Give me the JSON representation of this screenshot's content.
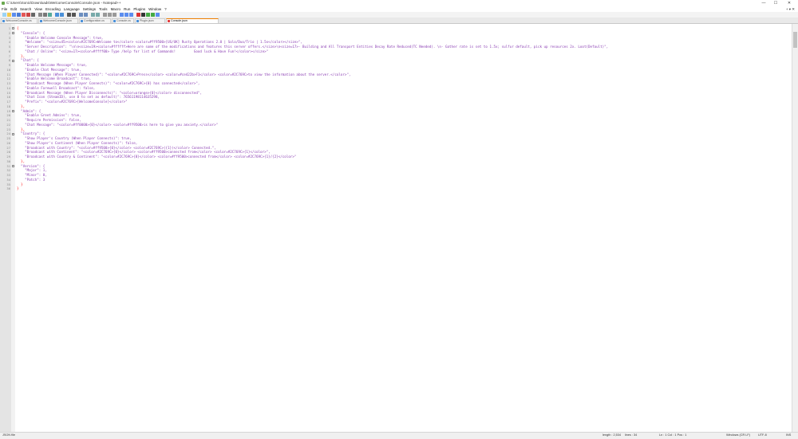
{
  "window": {
    "title": "C:\\Users\\Sonic\\Downloads\\WelcomeConsole\\Console.json - Notepad++",
    "controls": {
      "minimize": "—",
      "maximize": "☐",
      "close": "✕"
    }
  },
  "menu": {
    "items": [
      "File",
      "Edit",
      "Search",
      "View",
      "Encoding",
      "Language",
      "Settings",
      "Tools",
      "Macro",
      "Run",
      "Plugins",
      "Window",
      "?"
    ],
    "right": "+ ▾ ✕"
  },
  "tabs": [
    {
      "label": "WelcomeConsole.cs"
    },
    {
      "label": "WelcomeConsole.json"
    },
    {
      "label": "Configuration.cs"
    },
    {
      "label": "Console.cs"
    },
    {
      "label": "Plugin.json"
    },
    {
      "label": "Console.json"
    }
  ],
  "editor": {
    "lines": [
      "{",
      "  \"Console\": {",
      "    \"Enable Welcome Console Message\": true,",
      "    \"Welcome\": \"<size=45><color=#2C769C>Welcome to</color> <color=#ff9500>[US/UK] Rusty Operations 2.0 | Solo/Duo/Trio | 1.5x</color></size>\",",
      "    \"Server Description\": \"\\n\\n<size=19><color=#ffffff>Here are some of the modifications and features this server offers.</size>\\n<size=17>- Building and All Transport Entities Decay Rate Reduced(TC Needed). \\n- Gather rate is set to 1.5x; sulfur default, pick up resources 2x. Loot(Default)\",",
      "    \"Chat / Online\": \"<size=17><color=#ffff00> Type /help for list of Commands!         Good luck & Have Fun!</color></size>\"",
      "  },",
      "  \"Chat\": {",
      "    \"Enable Welcome Message\": true,",
      "    \"Enable Chat Message\": true,",
      "    \"Chat Message (When Player Connected)\": \"<color=#2C769C>Press</color> <color=#ce422b>F1</color> <color=#2C769C>to view the information about the server.</color>\",",
      "    \"Enable Welcome Broadcast\": true,",
      "    \"Broadcast Message (When Player Connects)\": \"<color=#2C769C>{0} has connected</color>\",",
      "    \"Enable Farewell Broadcast\": false,",
      "    \"Broadcast Message (When Player Disconnects)\": \"<color=orange>{0}</color> disconnected\",",
      "    \"Chat Icon (SteamID), use 0 to set as default)\": 76561198114635298,",
      "    \"Prefix\": \"<color=#2C769C>[WelcomeConsole]</color>\"",
      "  },",
      "  \"Admin\": {",
      "    \"Enable Greet Admins\": true,",
      "    \"Require Permission\": false,",
      "    \"Chat Message\": \"<color=#ff0000>{0}</color> <color=#ff9500>is here to give you anxiety.</color>\"",
      "  },",
      "  \"Country\": {",
      "    \"Show Player's Country (When Player Connects)\": true,",
      "    \"Show Player's Continent (When Player Connects)\": false,",
      "    \"Broadcast with Country\": \"<color=#ff9500>{0}</color> <color=#2C769C>({1})</color> Connected.\",",
      "    \"Broadcast with Continent\": \"<color=#2C769C>{0}</color> <color=#ff9500>connected from</color> <color=#2C769C>{1}</color>\",",
      "    \"Broadcast with Country & Continent\": \"<color=#2C769C>{0}</color> <color=#ff9500>connected from</color> <color=#2C769C>{1}/{2}</color>\"",
      "  },",
      "  \"Version\": {",
      "    \"Major\": 1,",
      "    \"Minor\": 0,",
      "    \"Patch\": 3",
      "  }",
      "}"
    ]
  },
  "status": {
    "type": "JSON file",
    "length": "length : 2,534",
    "lines": "lines : 34",
    "position": "Ln : 1    Col : 1    Pos : 1",
    "eol": "Windows (CR LF)",
    "encoding": "UTF-8",
    "mode": "INS"
  },
  "colors": {
    "key": "#8b3fb3",
    "number": "#ff8000",
    "tab_accent": "#f07f00"
  }
}
